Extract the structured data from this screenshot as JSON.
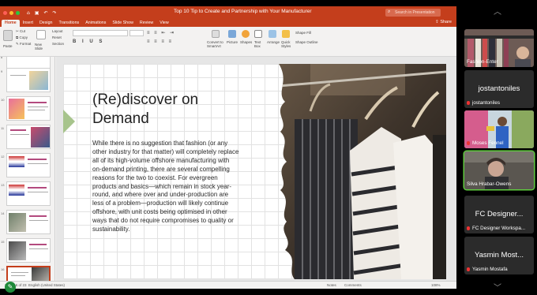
{
  "window": {
    "doc_title": "Top 10 Tip to Create and Partnership with Your Manufacturer",
    "search_placeholder": "Search in Presentation",
    "share_label": "Share"
  },
  "tabs": [
    {
      "label": "Home",
      "active": true
    },
    {
      "label": "Insert"
    },
    {
      "label": "Design"
    },
    {
      "label": "Transitions"
    },
    {
      "label": "Animations"
    },
    {
      "label": "Slide Show"
    },
    {
      "label": "Review"
    },
    {
      "label": "View"
    }
  ],
  "ribbon": {
    "paste": "Paste",
    "cut": "Cut",
    "copy": "Copy",
    "format": "Format",
    "new_slide": "New\nSlide",
    "layout": "Layout",
    "reset": "Reset",
    "section": "Section",
    "convert": "Convert to\nSmartArt",
    "picture": "Picture",
    "shapes": "Shapes",
    "text_box": "Text\nBox",
    "arrange": "Arrange",
    "quick_styles": "Quick\nStyles",
    "shape_fill": "Shape Fill",
    "shape_outline": "Shape Outline"
  },
  "slide": {
    "title": "(Re)discover on Demand",
    "body": "While there is no suggestion that fashion (or any other industry for that matter) will completely replace all of its high-volume offshore manufacturing with on-demand printing, there are several compelling reasons for the two to coexist. For evergreen products and basics—which remain in stock year-round, and where over and under-production are less of a problem—production will likely continue offshore, with unit costs being optimised in other ways that do not require compromises to quality or sustainability."
  },
  "thumbnails": [
    {
      "num": "8"
    },
    {
      "num": "9"
    },
    {
      "num": "10"
    },
    {
      "num": "11"
    },
    {
      "num": "12"
    },
    {
      "num": "13"
    },
    {
      "num": "14"
    },
    {
      "num": "15"
    },
    {
      "num": "16",
      "selected": true
    }
  ],
  "status": {
    "language": "English (United States)",
    "notes": "Notes",
    "comments": "Comments",
    "zoom": "108%"
  },
  "participants": [
    {
      "tile_name": "",
      "label": "Fashion-Enter",
      "type": "video",
      "muted": false
    },
    {
      "tile_name": "jostantoniles",
      "label": "jostantoniles",
      "type": "name",
      "muted": true
    },
    {
      "tile_name": "",
      "label": "Moses Fennel",
      "type": "video",
      "muted": true
    },
    {
      "tile_name": "",
      "label": "Silva Hrabar-Owens",
      "type": "video",
      "muted": false,
      "highlight": true
    },
    {
      "tile_name": "FC Designer...",
      "label": "FC Designer Workspa...",
      "type": "name",
      "muted": true
    },
    {
      "tile_name": "Yasmin Most...",
      "label": "Yasmin Mostafa",
      "type": "name",
      "muted": true
    }
  ],
  "colors": {
    "ppt_accent": "#c43e1c",
    "speaking_border": "#5fcc3e",
    "muted_icon": "#e33333"
  }
}
